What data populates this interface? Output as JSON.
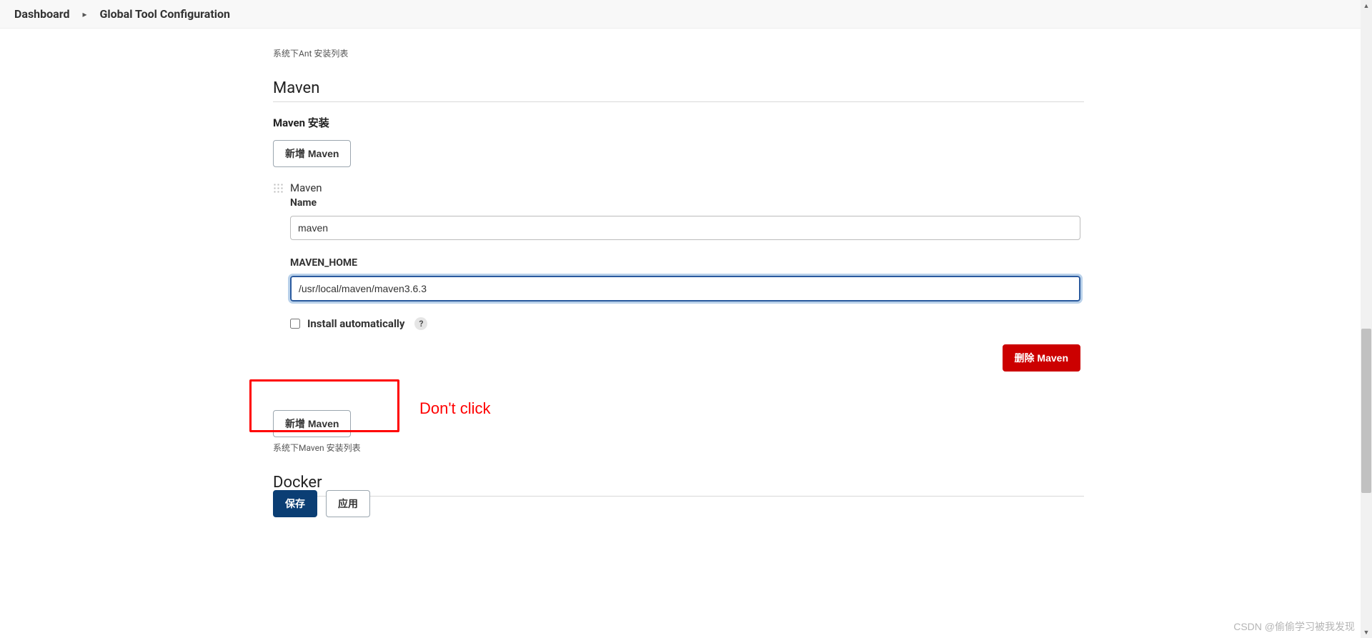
{
  "breadcrumb": {
    "root": "Dashboard",
    "separator": "▸",
    "current": "Global Tool Configuration"
  },
  "ant": {
    "list_hint": "系统下Ant 安装列表"
  },
  "maven": {
    "section_title": "Maven",
    "install_heading": "Maven 安装",
    "add_button": "新增 Maven",
    "tool_label": "Maven",
    "name_label": "Name",
    "name_value": "maven",
    "home_label": "MAVEN_HOME",
    "home_value": "/usr/local/maven/maven3.6.3",
    "install_auto_label": "Install automatically",
    "help_symbol": "?",
    "delete_button": "删除 Maven",
    "add_button_bottom": "新增 Maven",
    "list_hint": "系统下Maven 安装列表"
  },
  "docker": {
    "section_title": "Docker"
  },
  "footer": {
    "save": "保存",
    "apply": "应用"
  },
  "annotation": {
    "text": "Don't click"
  },
  "watermark": "CSDN @偷偷学习被我发现"
}
